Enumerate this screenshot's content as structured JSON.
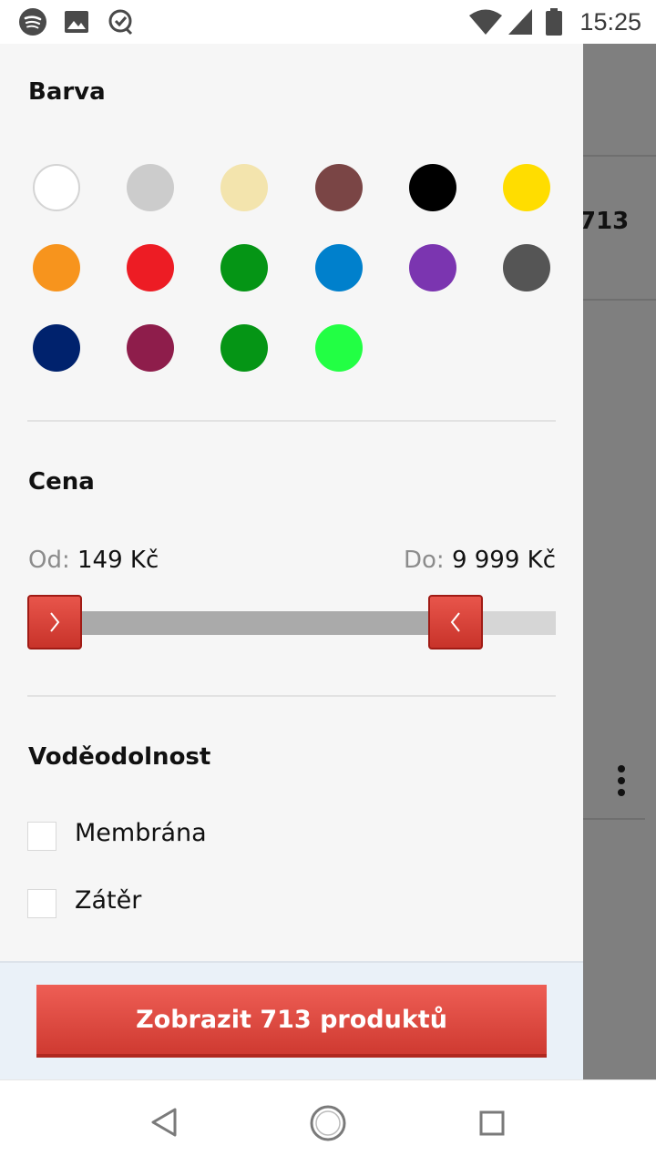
{
  "status_bar": {
    "time": "15:25",
    "left_icons": [
      "spotify-icon",
      "image-icon",
      "clock-check-icon"
    ],
    "right_icons": [
      "wifi-icon",
      "signal-icon",
      "battery-icon"
    ]
  },
  "background": {
    "product_count": "713"
  },
  "filters": {
    "color": {
      "title": "Barva",
      "swatches": [
        {
          "color": "#ffffff",
          "name": "white"
        },
        {
          "color": "#cccccc",
          "name": "light-gray"
        },
        {
          "color": "#f3e4ad",
          "name": "beige"
        },
        {
          "color": "#7a4545",
          "name": "brown"
        },
        {
          "color": "#000000",
          "name": "black"
        },
        {
          "color": "#ffdd00",
          "name": "yellow"
        },
        {
          "color": "#f7941d",
          "name": "orange"
        },
        {
          "color": "#ed1c24",
          "name": "red"
        },
        {
          "color": "#059515",
          "name": "green"
        },
        {
          "color": "#0080cc",
          "name": "blue"
        },
        {
          "color": "#7b35b0",
          "name": "purple"
        },
        {
          "color": "#555555",
          "name": "dark-gray"
        },
        {
          "color": "#00226d",
          "name": "navy"
        },
        {
          "color": "#8e1d4b",
          "name": "burgundy"
        },
        {
          "color": "#059515",
          "name": "green-2"
        },
        {
          "color": "#22ff44",
          "name": "light-green"
        }
      ]
    },
    "price": {
      "title": "Cena",
      "from_prefix": "Od:",
      "from_value": "149 Kč",
      "to_prefix": "Do:",
      "to_value": "9 999 Kč"
    },
    "waterproof": {
      "title": "Voděodolnost",
      "options": [
        {
          "label": "Membrána",
          "checked": false
        },
        {
          "label": "Zátěr",
          "checked": false
        }
      ]
    }
  },
  "footer": {
    "button_label": "Zobrazit 713 produktů"
  },
  "nav_bar": {
    "buttons": [
      "back-icon",
      "home-icon",
      "recents-icon"
    ]
  }
}
